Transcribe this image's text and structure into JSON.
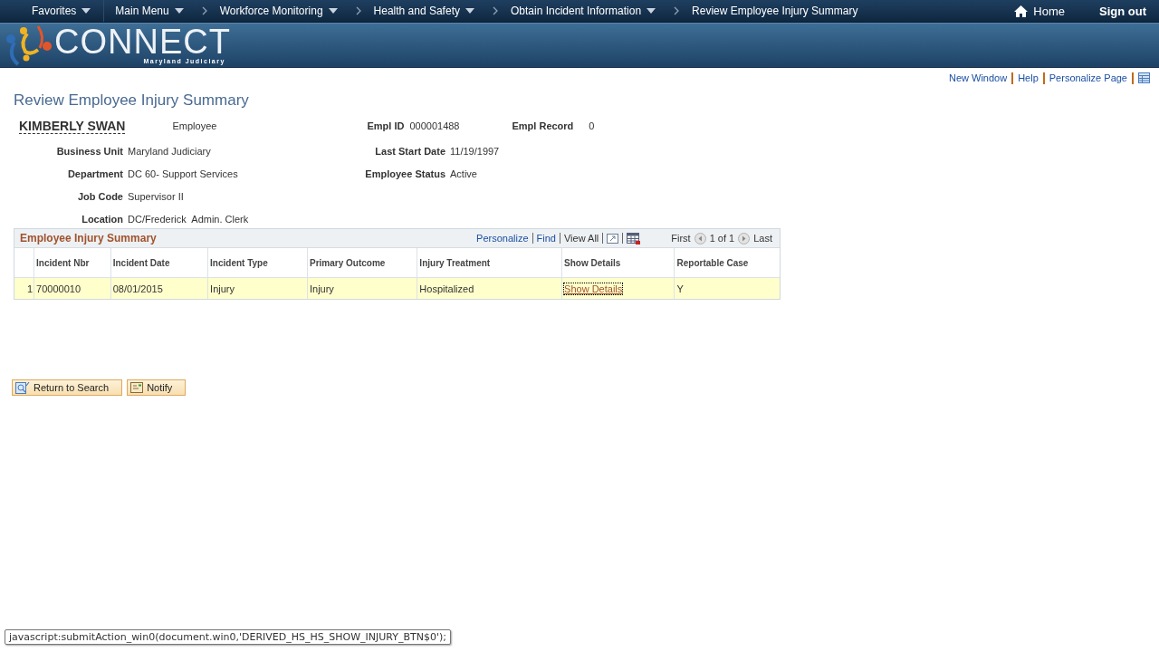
{
  "nav": {
    "items": [
      {
        "label": "Favorites",
        "dropdown": true,
        "separator": false
      },
      {
        "label": "Main Menu",
        "dropdown": true,
        "separator": false
      },
      {
        "label": "Workforce Monitoring",
        "dropdown": true,
        "separator": true
      },
      {
        "label": "Health and Safety",
        "dropdown": true,
        "separator": true
      },
      {
        "label": "Obtain Incident Information",
        "dropdown": true,
        "separator": true
      },
      {
        "label": "Review Employee Injury Summary",
        "dropdown": false,
        "separator": true
      }
    ],
    "home": "Home",
    "signout": "Sign out"
  },
  "banner": {
    "logo": "CONNECT",
    "subtitle": "Maryland Judiciary"
  },
  "page_links": [
    "New Window",
    "Help",
    "Personalize Page"
  ],
  "title": "Review Employee Injury Summary",
  "employee": {
    "name": "KIMBERLY SWAN",
    "role": "Employee",
    "id_label": "Empl ID",
    "id": "000001488",
    "record_label": "Empl Record",
    "record": "0"
  },
  "fields_left": [
    {
      "label": "Business Unit",
      "value": "Maryland Judiciary"
    },
    {
      "label": "Department",
      "value": "DC 60- Support Services"
    },
    {
      "label": "Job Code",
      "value": "Supervisor II"
    },
    {
      "label": "Location",
      "value": "DC/Frederick  Admin. Clerk"
    }
  ],
  "fields_right": [
    {
      "label": "Last Start Date",
      "value": "11/19/1997"
    },
    {
      "label": "Employee Status",
      "value": "Active"
    }
  ],
  "grid": {
    "title": "Employee Injury Summary",
    "links": [
      "Personalize",
      "Find"
    ],
    "view_all": "View All",
    "first": "First",
    "range": "1 of 1",
    "last": "Last",
    "columns": [
      "Incident Nbr",
      "Incident Date",
      "Incident Type",
      "Primary Outcome",
      "Injury Treatment",
      "Show Details",
      "Reportable Case"
    ],
    "rows": [
      {
        "num": "1",
        "selected": true,
        "cells": [
          "70000010",
          "08/01/2015",
          "Injury",
          "Injury",
          "Hospitalized",
          "Show Details",
          "Y"
        ]
      }
    ]
  },
  "buttons": [
    {
      "kind": "search",
      "label": "Return to Search"
    },
    {
      "kind": "notify",
      "label": "Notify"
    }
  ],
  "status_text": "javascript:submitAction_win0(document.win0,'DERIVED_HS_HS_SHOW_INJURY_BTN$0');"
}
